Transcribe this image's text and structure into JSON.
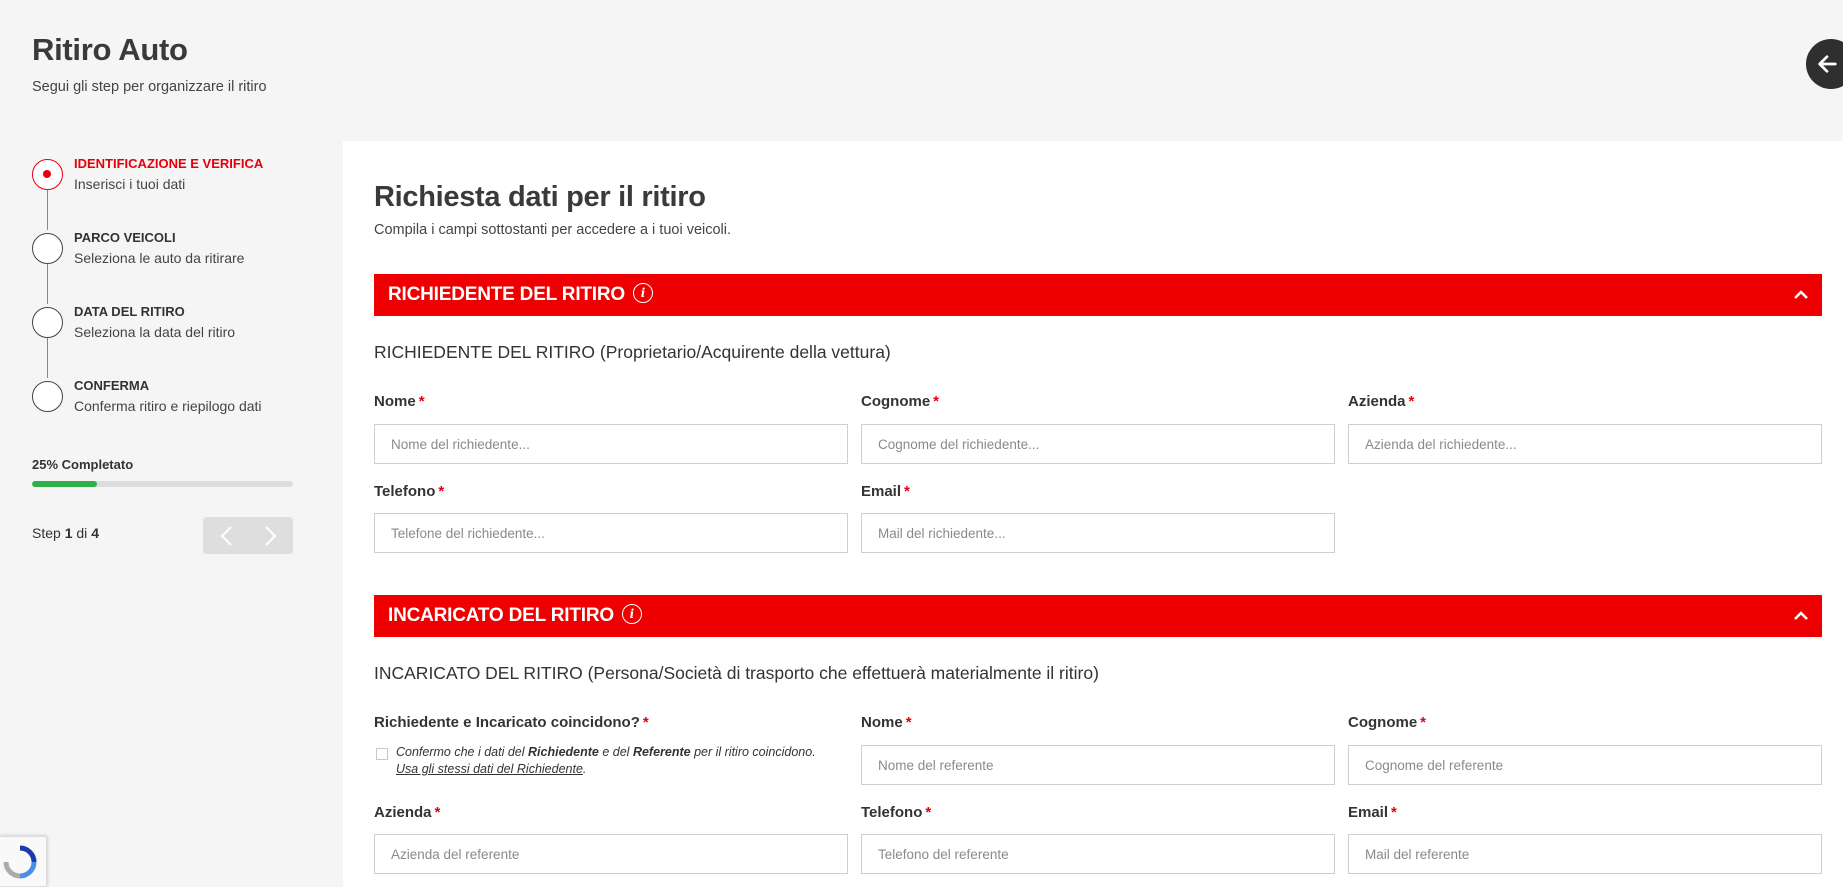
{
  "header": {
    "title": "Ritiro Auto",
    "subtitle": "Segui gli step per organizzare il ritiro"
  },
  "stepper": {
    "steps": [
      {
        "title": "IDENTIFICAZIONE E VERIFICA",
        "subtitle": "Inserisci i tuoi dati",
        "active": true
      },
      {
        "title": "PARCO VEICOLI",
        "subtitle": "Seleziona le auto da ritirare",
        "active": false
      },
      {
        "title": "DATA DEL RITIRO",
        "subtitle": "Seleziona la data del ritiro",
        "active": false
      },
      {
        "title": "CONFERMA",
        "subtitle": "Conferma ritiro e riepilogo dati",
        "active": false
      }
    ],
    "progress_label": "25% Completato",
    "progress_percent": 25,
    "counter_prefix": "Step",
    "current_step": "1",
    "counter_of": "di",
    "total_steps": "4"
  },
  "main": {
    "title": "Richiesta dati per il ritiro",
    "subtitle": "Compila i campi sottostanti per accedere a i tuoi veicoli.",
    "section1": {
      "bar_title": "RICHIEDENTE DEL RITIRO",
      "heading": "RICHIEDENTE DEL RITIRO",
      "heading_paren": "(Proprietario/Acquirente della vettura)",
      "fields": {
        "nome": {
          "label": "Nome",
          "placeholder": "Nome del richiedente..."
        },
        "cognome": {
          "label": "Cognome",
          "placeholder": "Cognome del richiedente..."
        },
        "azienda": {
          "label": "Azienda",
          "placeholder": "Azienda del richiedente..."
        },
        "telefono": {
          "label": "Telefono",
          "placeholder": "Telefone del richiedente..."
        },
        "email": {
          "label": "Email",
          "placeholder": "Mail del richiedente..."
        }
      }
    },
    "section2": {
      "bar_title": "INCARICATO DEL RITIRO",
      "heading": "INCARICATO DEL RITIRO",
      "heading_paren": "(Persona/Società di trasporto che effettuerà materialmente il ritiro)",
      "coincide_label": "Richiedente e Incaricato coincidono?",
      "checkbox": {
        "t1": "Confermo che i dati del ",
        "b1": "Richiedente",
        "t2": " e del ",
        "b2": "Referente",
        "t3": " per il ritiro coincidono.",
        "link": "Usa gli stessi dati del Richiedente",
        "t4": "."
      },
      "fields": {
        "nome": {
          "label": "Nome",
          "placeholder": "Nome del referente"
        },
        "cognome": {
          "label": "Cognome",
          "placeholder": "Cognome del referente"
        },
        "azienda": {
          "label": "Azienda",
          "placeholder": "Azienda del referente"
        },
        "telefono": {
          "label": "Telefono",
          "placeholder": "Telefono del referente"
        },
        "email": {
          "label": "Email",
          "placeholder": "Mail del referente"
        }
      }
    },
    "required_mark": "*",
    "info_mark": "i"
  },
  "colors": {
    "accent": "#e3000b",
    "section_bar": "#ee0000",
    "progress": "#2fb14a"
  },
  "icons": {
    "back": "arrow-left-icon",
    "prev": "chevron-left-icon",
    "next": "chevron-right-icon",
    "collapse": "chevron-up-icon",
    "info": "info-icon",
    "recaptcha": "recaptcha-icon"
  }
}
